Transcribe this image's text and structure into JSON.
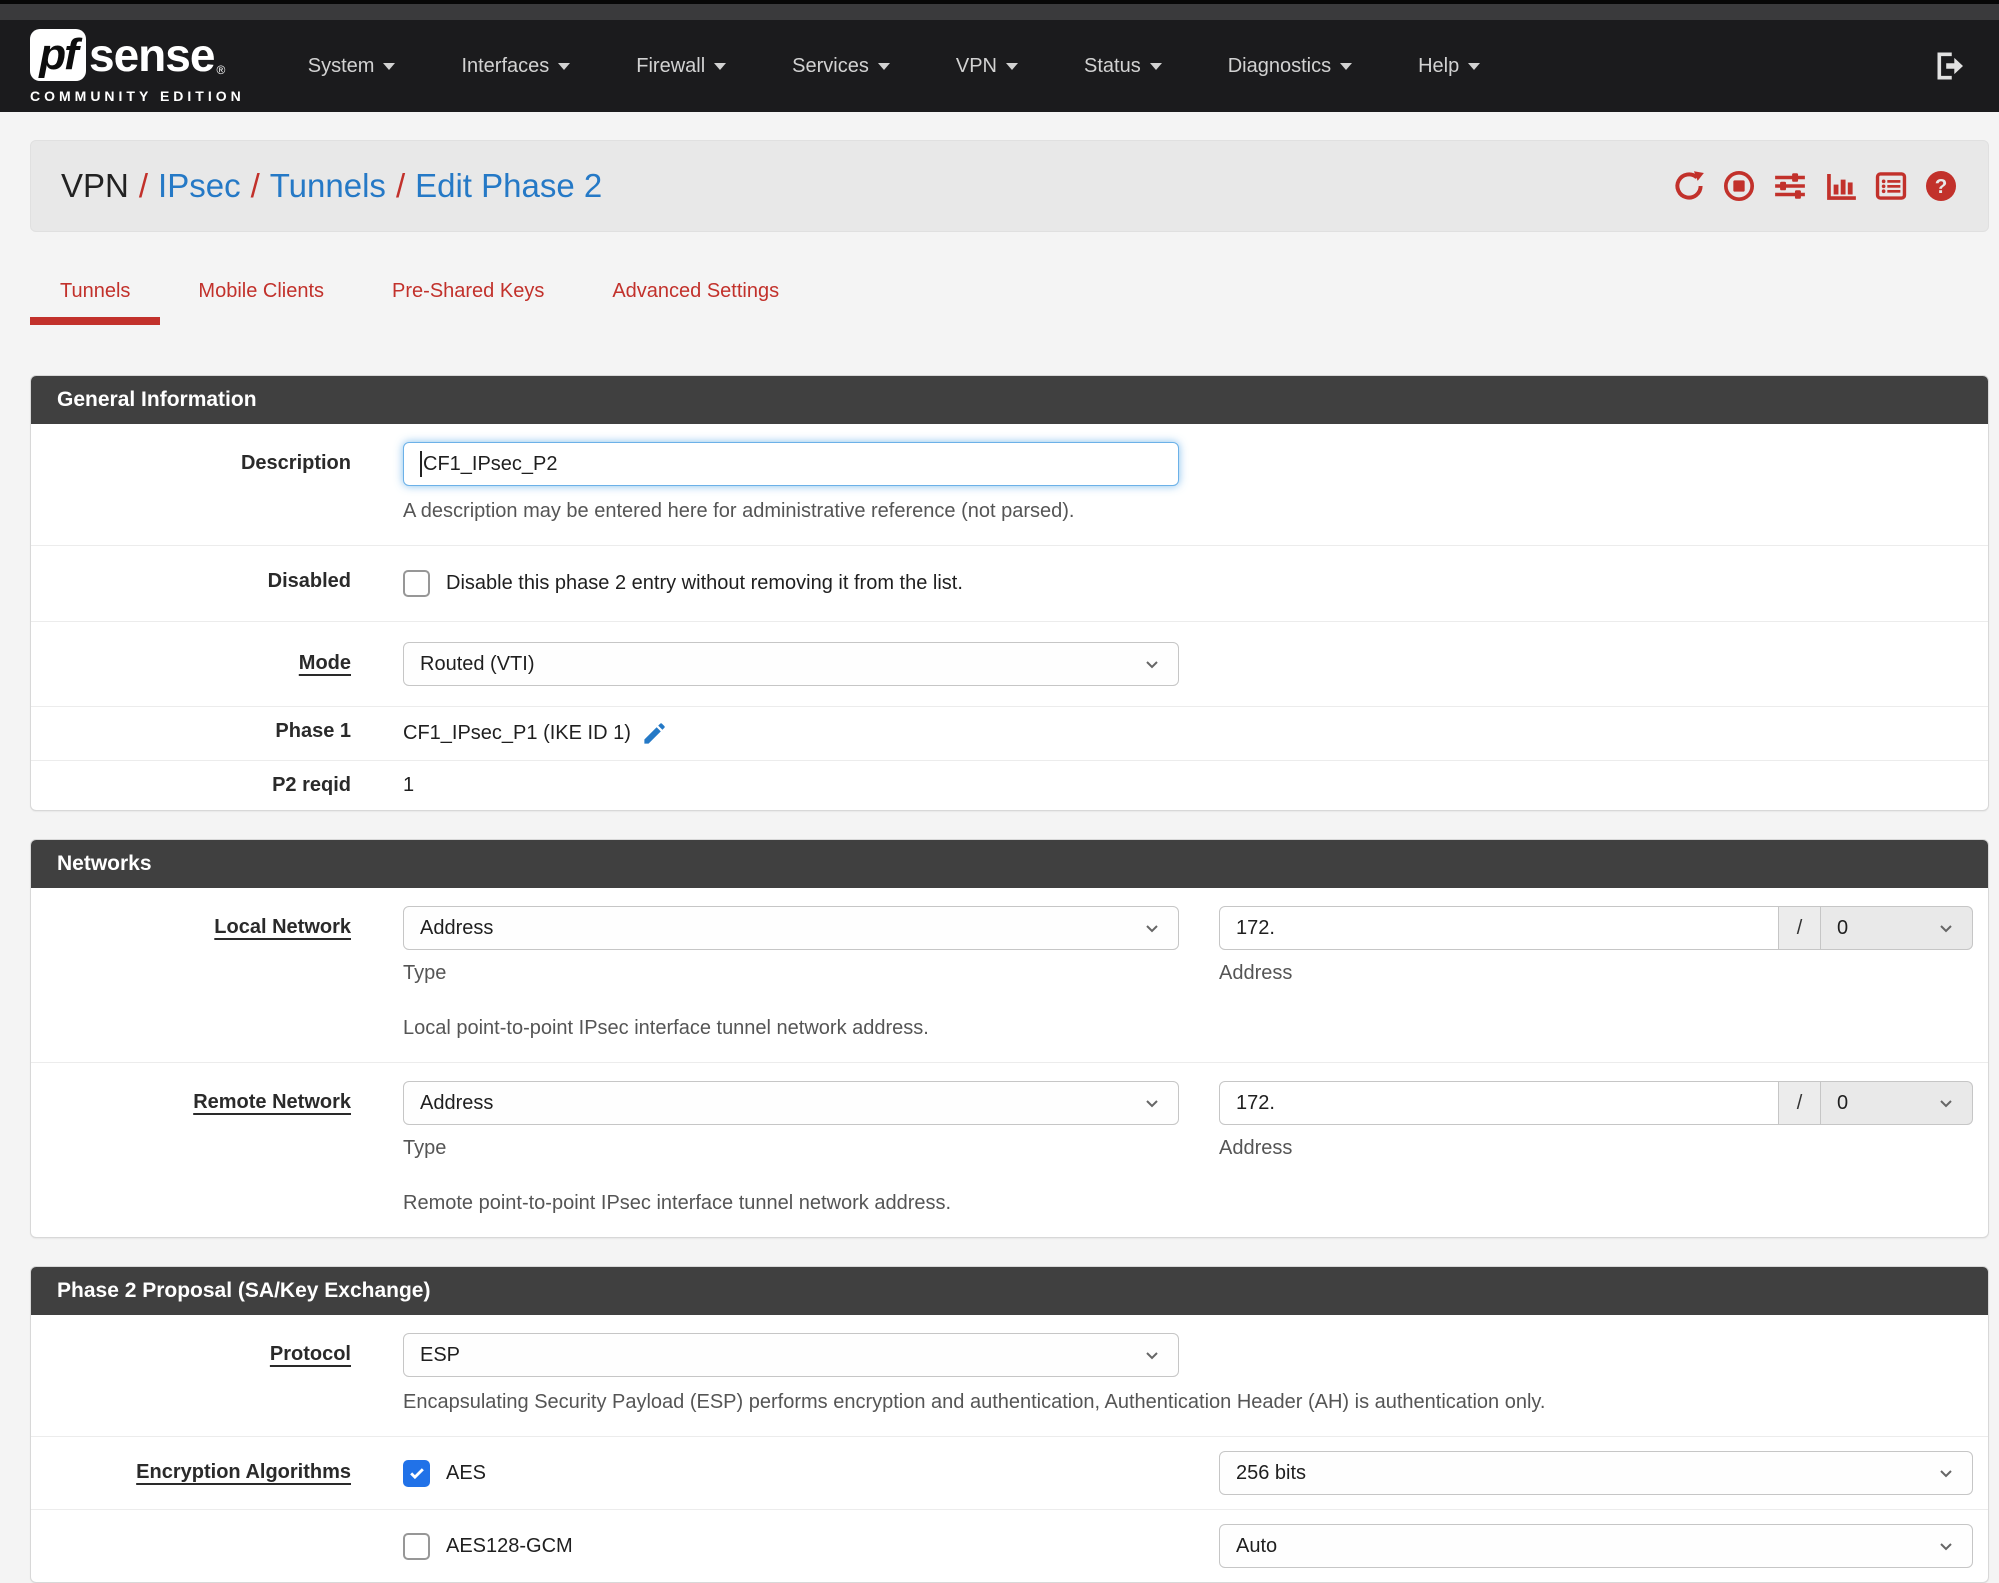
{
  "navbar": {
    "logo_pf": "pf",
    "logo_sense": "sense",
    "logo_reg": "®",
    "logo_subtitle": "COMMUNITY EDITION",
    "items": [
      {
        "label": "System"
      },
      {
        "label": "Interfaces"
      },
      {
        "label": "Firewall"
      },
      {
        "label": "Services"
      },
      {
        "label": "VPN"
      },
      {
        "label": "Status"
      },
      {
        "label": "Diagnostics"
      },
      {
        "label": "Help"
      }
    ]
  },
  "icons": {
    "navbar_right": "sign-out-icon",
    "breadcrumb": [
      "refresh-icon",
      "stop-icon",
      "sliders-icon",
      "bar-chart-icon",
      "list-icon",
      "help-icon"
    ],
    "phase1_edit": "pencil-icon",
    "select_chevron": "chevron-down-icon"
  },
  "breadcrumb": {
    "root": "VPN",
    "sep": "/",
    "link1": "IPsec",
    "link2": "Tunnels",
    "link3": "Edit Phase 2"
  },
  "tabs": [
    {
      "label": "Tunnels",
      "active": true
    },
    {
      "label": "Mobile Clients",
      "active": false
    },
    {
      "label": "Pre-Shared Keys",
      "active": false
    },
    {
      "label": "Advanced Settings",
      "active": false
    }
  ],
  "general": {
    "title": "General Information",
    "description_label": "Description",
    "description_value": "CF1_IPsec_P2",
    "description_help": "A description may be entered here for administrative reference (not parsed).",
    "disabled_label": "Disabled",
    "disabled_checkbox_label": "Disable this phase 2 entry without removing it from the list.",
    "disabled_checked": false,
    "mode_label": "Mode",
    "mode_value": "Routed (VTI)",
    "phase1_label": "Phase 1",
    "phase1_value": "CF1_IPsec_P1 (IKE ID 1)",
    "p2reqid_label": "P2 reqid",
    "p2reqid_value": "1"
  },
  "networks": {
    "title": "Networks",
    "local": {
      "label": "Local Network",
      "type_value": "Address",
      "type_sublabel": "Type",
      "address_value": "172.",
      "address_sublabel": "Address",
      "slash": "/",
      "prefix_value": "0",
      "help": "Local point-to-point IPsec interface tunnel network address."
    },
    "remote": {
      "label": "Remote Network",
      "type_value": "Address",
      "type_sublabel": "Type",
      "address_value": "172.",
      "address_sublabel": "Address",
      "slash": "/",
      "prefix_value": "0",
      "help": "Remote point-to-point IPsec interface tunnel network address."
    }
  },
  "proposal": {
    "title": "Phase 2 Proposal (SA/Key Exchange)",
    "protocol_label": "Protocol",
    "protocol_value": "ESP",
    "protocol_help": "Encapsulating Security Payload (ESP) performs encryption and authentication, Authentication Header (AH) is authentication only.",
    "encryption_label": "Encryption Algorithms",
    "algorithms": [
      {
        "name": "AES",
        "checked": true,
        "bits": "256 bits"
      },
      {
        "name": "AES128-GCM",
        "checked": false,
        "bits": "Auto"
      }
    ]
  },
  "colors": {
    "accent_red": "#c2312b",
    "link_blue": "#2579c6",
    "checkbox_blue": "#2172e8",
    "panel_header_dark": "#404040",
    "navbar_bg": "#1b1b1d"
  }
}
